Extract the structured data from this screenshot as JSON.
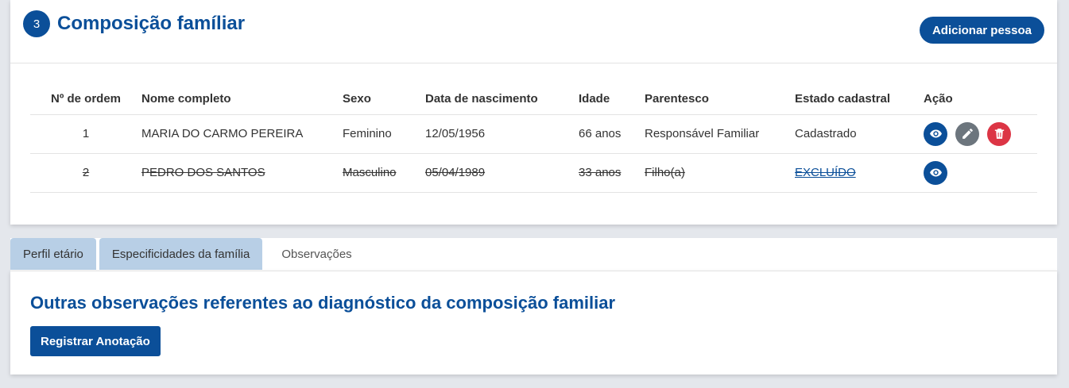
{
  "section": {
    "step": "3",
    "title": "Composição famíliar",
    "add_button": "Adicionar pessoa"
  },
  "table": {
    "headers": [
      "Nº de ordem",
      "Nome completo",
      "Sexo",
      "Data de nascimento",
      "Idade",
      "Parentesco",
      "Estado cadastral",
      "Ação"
    ],
    "rows": [
      {
        "ordem": "1",
        "nome": "MARIA DO CARMO PEREIRA",
        "sexo": "Feminino",
        "nascimento": "12/05/1956",
        "idade": "66 anos",
        "parentesco": "Responsável Familiar",
        "estado": "Cadastrado",
        "deleted": false,
        "actions": [
          "eye-icon",
          "pencil-icon",
          "trash-icon"
        ]
      },
      {
        "ordem": "2",
        "nome": "PEDRO DOS SANTOS",
        "sexo": "Masculino",
        "nascimento": "05/04/1989",
        "idade": "33 anos",
        "parentesco": "Filho(a)",
        "estado": "EXCLUÍDO",
        "deleted": true,
        "actions": [
          "eye-icon"
        ]
      }
    ]
  },
  "tabs": [
    {
      "label": "Perfil etário",
      "active": false
    },
    {
      "label": "Especificidades da família",
      "active": false
    },
    {
      "label": "Observações",
      "active": true
    }
  ],
  "observacoes": {
    "title": "Outras observações referentes ao diagnóstico da composição familiar",
    "register_button": "Registrar Anotação"
  },
  "colors": {
    "primary": "#0b4f99",
    "tab_inactive": "#b8cfe6",
    "edit": "#6c757d",
    "delete": "#dc3545"
  }
}
